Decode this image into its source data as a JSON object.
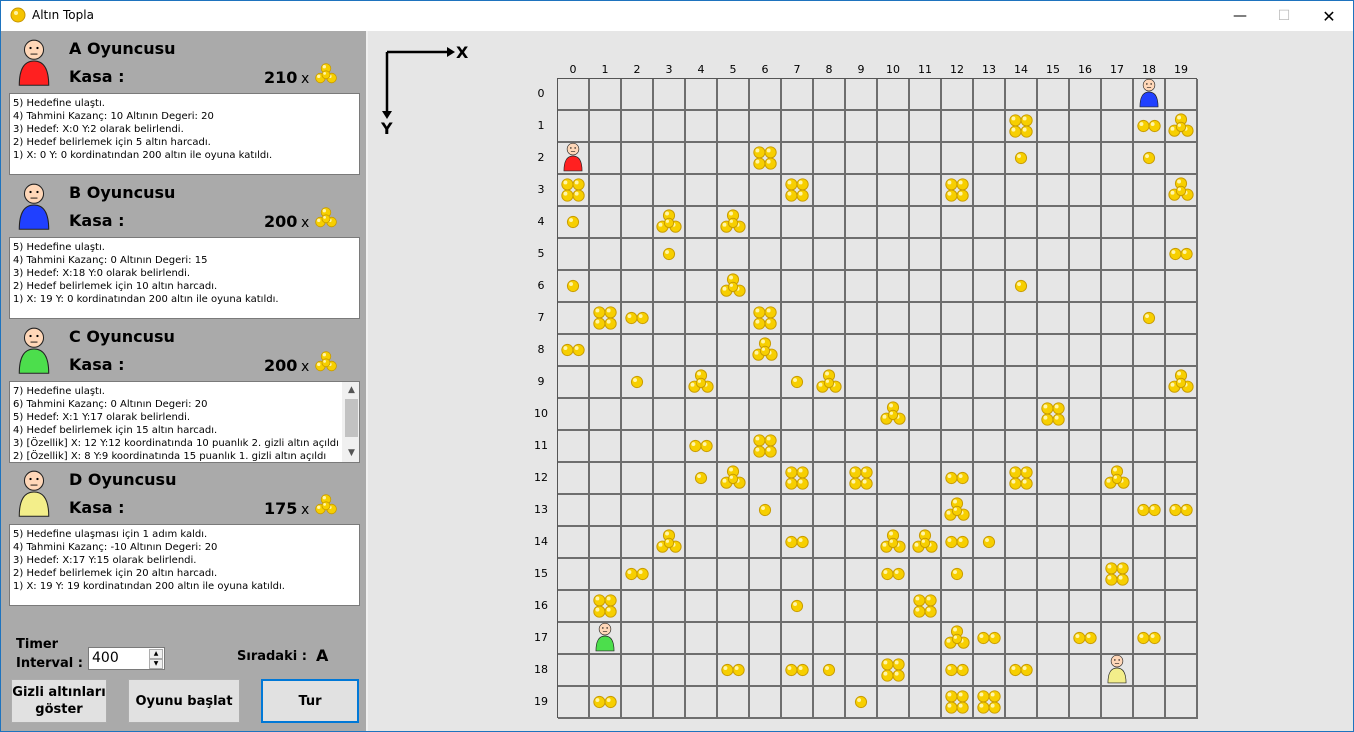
{
  "window": {
    "title": "Altın Topla",
    "minimize": "—",
    "maximize": "☐",
    "close": "✕"
  },
  "players": [
    {
      "name": "A Oyuncusu",
      "kasa_label": "Kasa :",
      "kasa": "210",
      "x": "x",
      "color": "#ff2020",
      "log": [
        "5)  Hedefine ulaştı.",
        "4)  Tahmini Kazanç: 10 Altının Degeri: 20",
        "3)  Hedef: X:0 Y:2 olarak belirlendi.",
        "2)  Hedef belirlemek için 5 altın harcadı.",
        "1)  X: 0 Y: 0 kordinatından 200 altın ile oyuna katıldı."
      ]
    },
    {
      "name": "B Oyuncusu",
      "kasa_label": "Kasa :",
      "kasa": "200",
      "x": "x",
      "color": "#2040ff",
      "log": [
        "5)  Hedefine ulaştı.",
        "4)  Tahmini Kazanç: 0 Altının Degeri: 15",
        "3)  Hedef: X:18 Y:0 olarak belirlendi.",
        "2)  Hedef belirlemek için 10 altın harcadı.",
        "1)  X: 19 Y: 0 kordinatından 200 altın ile oyuna katıldı."
      ]
    },
    {
      "name": "C Oyuncusu",
      "kasa_label": "Kasa :",
      "kasa": "200",
      "x": "x",
      "color": "#4cde4c",
      "log": [
        "7)  Hedefine ulaştı.",
        "6)  Tahmini Kazanç: 0 Altının Degeri: 20",
        "5)  Hedef: X:1 Y:17 olarak belirlendi.",
        "4)  Hedef belirlemek için 15 altın harcadı.",
        "3)  [Özellik] X: 12 Y:12 koordinatında 10 puanlık 2. gizli altın açıldı",
        "2)  [Özellik] X: 8 Y:9 koordinatında 15 puanlık 1. gizli altın açıldı"
      ]
    },
    {
      "name": "D Oyuncusu",
      "kasa_label": "Kasa :",
      "kasa": "175",
      "x": "x",
      "color": "#f3ee8a",
      "log": [
        "5)  Hedefine ulaşması için 1 adım kaldı.",
        "4)  Tahmini Kazanç: -10 Altının Degeri: 20",
        "3)  Hedef: X:17 Y:15 olarak belirlendi.",
        "2)  Hedef belirlemek için 20 altın harcadı.",
        "1)  X: 19 Y: 19 kordinatından 200 altın ile oyuna katıldı."
      ]
    }
  ],
  "controls": {
    "timer_label_1": "Timer",
    "timer_label_2": "Interval :",
    "timer_value": "400",
    "next_label": "Sıradaki :",
    "next_value": "A",
    "btn_hidden_1": "Gizli altınları",
    "btn_hidden_2": "göster",
    "btn_start": "Oyunu başlat",
    "btn_turn": "Tur"
  },
  "board": {
    "x_axis": "X",
    "y_axis": "Y",
    "columns": [
      "0",
      "1",
      "2",
      "3",
      "4",
      "5",
      "6",
      "7",
      "8",
      "9",
      "10",
      "11",
      "12",
      "13",
      "14",
      "15",
      "16",
      "17",
      "18",
      "19"
    ],
    "rows": [
      "0",
      "1",
      "2",
      "3",
      "4",
      "5",
      "6",
      "7",
      "8",
      "9",
      "10",
      "11",
      "12",
      "13",
      "14",
      "15",
      "16",
      "17",
      "18",
      "19"
    ],
    "players_on_board": [
      {
        "player": "A",
        "col": 0,
        "row": 2,
        "color": "#ff2020"
      },
      {
        "player": "B",
        "col": 18,
        "row": 0,
        "color": "#2040ff"
      },
      {
        "player": "C",
        "col": 1,
        "row": 17,
        "color": "#4cde4c"
      },
      {
        "player": "D",
        "col": 17,
        "row": 18,
        "color": "#f3ee8a"
      }
    ],
    "gold": [
      [
        14,
        1,
        "medium"
      ],
      [
        18,
        1,
        "small"
      ],
      [
        19,
        1,
        "large"
      ],
      [
        6,
        2,
        "medium"
      ],
      [
        14,
        2,
        "single"
      ],
      [
        18,
        2,
        "single"
      ],
      [
        0,
        3,
        "medium"
      ],
      [
        7,
        3,
        "medium"
      ],
      [
        12,
        3,
        "medium"
      ],
      [
        19,
        3,
        "large"
      ],
      [
        0,
        4,
        "single"
      ],
      [
        3,
        4,
        "large"
      ],
      [
        5,
        4,
        "large"
      ],
      [
        3,
        5,
        "single"
      ],
      [
        19,
        5,
        "small"
      ],
      [
        0,
        6,
        "single"
      ],
      [
        5,
        6,
        "large"
      ],
      [
        14,
        6,
        "single"
      ],
      [
        1,
        7,
        "medium"
      ],
      [
        2,
        7,
        "small"
      ],
      [
        6,
        7,
        "medium"
      ],
      [
        18,
        7,
        "single"
      ],
      [
        0,
        8,
        "small"
      ],
      [
        6,
        8,
        "large"
      ],
      [
        2,
        9,
        "single"
      ],
      [
        4,
        9,
        "large"
      ],
      [
        7,
        9,
        "single"
      ],
      [
        8,
        9,
        "large"
      ],
      [
        19,
        9,
        "large"
      ],
      [
        10,
        10,
        "large"
      ],
      [
        15,
        10,
        "medium"
      ],
      [
        4,
        11,
        "small"
      ],
      [
        6,
        11,
        "medium"
      ],
      [
        4,
        12,
        "single"
      ],
      [
        5,
        12,
        "large"
      ],
      [
        7,
        12,
        "medium"
      ],
      [
        9,
        12,
        "medium"
      ],
      [
        12,
        12,
        "small"
      ],
      [
        14,
        12,
        "medium"
      ],
      [
        17,
        12,
        "large"
      ],
      [
        6,
        13,
        "single"
      ],
      [
        12,
        13,
        "large"
      ],
      [
        18,
        13,
        "small"
      ],
      [
        19,
        13,
        "small"
      ],
      [
        3,
        14,
        "large"
      ],
      [
        7,
        14,
        "small"
      ],
      [
        10,
        14,
        "large"
      ],
      [
        11,
        14,
        "large"
      ],
      [
        12,
        14,
        "small"
      ],
      [
        13,
        14,
        "single"
      ],
      [
        2,
        15,
        "small"
      ],
      [
        10,
        15,
        "small"
      ],
      [
        12,
        15,
        "single"
      ],
      [
        17,
        15,
        "medium"
      ],
      [
        1,
        16,
        "medium"
      ],
      [
        7,
        16,
        "single"
      ],
      [
        11,
        16,
        "medium"
      ],
      [
        12,
        17,
        "large"
      ],
      [
        13,
        17,
        "small"
      ],
      [
        16,
        17,
        "small"
      ],
      [
        18,
        17,
        "small"
      ],
      [
        5,
        18,
        "small"
      ],
      [
        7,
        18,
        "small"
      ],
      [
        8,
        18,
        "single"
      ],
      [
        10,
        18,
        "medium"
      ],
      [
        12,
        18,
        "small"
      ],
      [
        14,
        18,
        "small"
      ],
      [
        1,
        19,
        "small"
      ],
      [
        9,
        19,
        "single"
      ],
      [
        12,
        19,
        "medium"
      ],
      [
        13,
        19,
        "medium"
      ]
    ],
    "gold_color": "#ffd700"
  }
}
